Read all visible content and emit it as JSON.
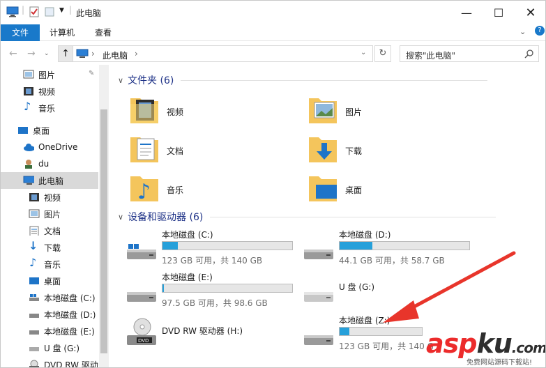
{
  "window": {
    "title": "此电脑"
  },
  "ribbon": {
    "tabs": [
      "文件",
      "计算机",
      "查看"
    ]
  },
  "address": {
    "path": "此电脑",
    "search_placeholder": "搜索\"此电脑\""
  },
  "nav": {
    "items": [
      {
        "label": "图片",
        "icon": "pictures-icon"
      },
      {
        "label": "视频",
        "icon": "videos-icon"
      },
      {
        "label": "音乐",
        "icon": "music-icon"
      },
      {
        "label": "桌面",
        "icon": "desktop-icon"
      },
      {
        "label": "OneDrive",
        "icon": "onedrive-icon"
      },
      {
        "label": "du",
        "icon": "user-icon"
      },
      {
        "label": "此电脑",
        "icon": "this-pc-icon"
      },
      {
        "label": "视频",
        "icon": "videos-icon"
      },
      {
        "label": "图片",
        "icon": "pictures-icon"
      },
      {
        "label": "文档",
        "icon": "documents-icon"
      },
      {
        "label": "下载",
        "icon": "downloads-icon"
      },
      {
        "label": "音乐",
        "icon": "music-icon"
      },
      {
        "label": "桌面",
        "icon": "desktop-icon"
      },
      {
        "label": "本地磁盘 (C:)",
        "icon": "drive-icon"
      },
      {
        "label": "本地磁盘 (D:)",
        "icon": "drive-icon"
      },
      {
        "label": "本地磁盘 (E:)",
        "icon": "drive-icon"
      },
      {
        "label": "U 盘 (G:)",
        "icon": "usb-drive-icon"
      },
      {
        "label": "DVD RW 驱动",
        "icon": "dvd-drive-icon"
      }
    ]
  },
  "folders": {
    "header": "文件夹 (6)",
    "items": [
      {
        "label": "视频",
        "icon": "videos-folder-icon"
      },
      {
        "label": "图片",
        "icon": "pictures-folder-icon"
      },
      {
        "label": "文档",
        "icon": "documents-folder-icon"
      },
      {
        "label": "下载",
        "icon": "downloads-folder-icon"
      },
      {
        "label": "音乐",
        "icon": "music-folder-icon"
      },
      {
        "label": "桌面",
        "icon": "desktop-folder-icon"
      }
    ]
  },
  "devices": {
    "header": "设备和驱动器 (6)",
    "items": [
      {
        "name": "本地磁盘 (C:)",
        "free": "123 GB 可用，共 140 GB",
        "used_fraction": 0.12
      },
      {
        "name": "本地磁盘 (D:)",
        "free": "44.1 GB 可用，共 58.7 GB",
        "used_fraction": 0.25
      },
      {
        "name": "本地磁盘 (E:)",
        "free": "97.5 GB 可用，共 98.6 GB",
        "used_fraction": 0.01
      },
      {
        "name": "U 盘 (G:)",
        "free": "",
        "used_fraction": null
      },
      {
        "name": "DVD RW 驱动器 (H:)",
        "free": "",
        "used_fraction": null
      },
      {
        "name": "本地磁盘 (Z:)",
        "free": "123 GB 可用，共 140 G",
        "used_fraction": 0.12
      }
    ]
  },
  "watermark": {
    "asp": "asp",
    "ku": "ku",
    "dom": ".com",
    "sub": "免费网站源码下载站!"
  }
}
